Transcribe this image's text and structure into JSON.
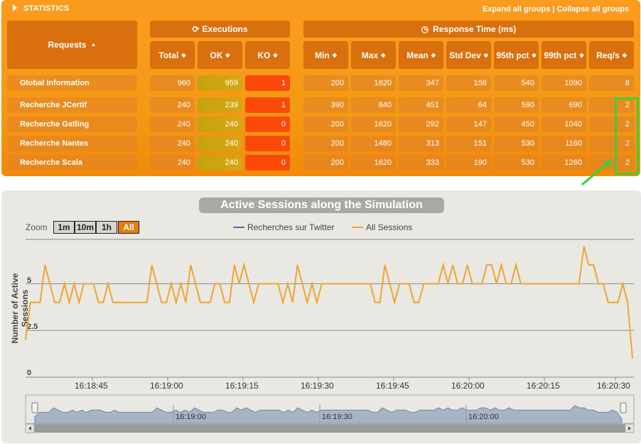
{
  "stats": {
    "title": "STATISTICS",
    "expand": "Expand all groups",
    "sep": " | ",
    "collapse": "Collapse all groups",
    "requests_header": "Requests",
    "executions_header": "Executions",
    "response_header": "Response Time (ms)",
    "columns": [
      "Total",
      "OK",
      "KO",
      "Min",
      "Max",
      "Mean",
      "Std Dev",
      "95th pct",
      "99th pct",
      "Req/s"
    ],
    "rows": [
      {
        "name": "Global Information",
        "total": "960",
        "ok": "959",
        "ko": "1",
        "min": "200",
        "max": "1620",
        "mean": "347",
        "std": "158",
        "p95": "540",
        "p99": "1090",
        "reqs": "8"
      },
      {
        "name": "Recherche JCertif",
        "total": "240",
        "ok": "239",
        "ko": "1",
        "min": "390",
        "max": "840",
        "mean": "451",
        "std": "64",
        "p95": "590",
        "p99": "690",
        "reqs": "2"
      },
      {
        "name": "Recherche Gatling",
        "total": "240",
        "ok": "240",
        "ko": "0",
        "min": "200",
        "max": "1620",
        "mean": "292",
        "std": "147",
        "p95": "450",
        "p99": "1040",
        "reqs": "2"
      },
      {
        "name": "Recherche Nantes",
        "total": "240",
        "ok": "240",
        "ko": "0",
        "min": "200",
        "max": "1480",
        "mean": "313",
        "std": "151",
        "p95": "530",
        "p99": "1160",
        "reqs": "2"
      },
      {
        "name": "Recherche Scala",
        "total": "240",
        "ok": "240",
        "ko": "0",
        "min": "200",
        "max": "1620",
        "mean": "333",
        "std": "190",
        "p95": "530",
        "p99": "1260",
        "reqs": "2"
      }
    ]
  },
  "chart": {
    "title": "Active Sessions along the Simulation",
    "zoom_label": "Zoom",
    "zoom_buttons": [
      "1m",
      "10m",
      "1h",
      "All"
    ],
    "ylabel": "Number of Active Sessions",
    "colors": {
      "twitter": "#4572a7",
      "all": "#f0a430"
    }
  },
  "chart_data": {
    "type": "line",
    "title": "Active Sessions along the Simulation",
    "ylabel": "Number of Active Sessions",
    "ylim": [
      0,
      7
    ],
    "yticks": [
      "0",
      "2.5",
      "5"
    ],
    "xticks": [
      "16:18:45",
      "16:19:00",
      "16:19:15",
      "16:19:30",
      "16:19:45",
      "16:20:00",
      "16:20:15",
      "16:20:30"
    ],
    "navigator_ticks": [
      "16:19:00",
      "16:19:30",
      "16:20:00"
    ],
    "series": [
      {
        "name": "Recherches sur Twitter",
        "values": []
      },
      {
        "name": "All Sessions",
        "values": [
          2,
          4,
          4,
          4,
          6,
          5,
          4,
          4,
          5,
          4,
          5,
          4,
          5,
          5,
          5,
          4,
          4,
          5,
          4,
          4,
          4,
          4,
          4,
          4,
          4,
          4,
          6,
          5,
          4,
          4,
          5,
          4,
          5,
          4,
          6,
          5,
          4,
          4,
          4,
          5,
          5,
          4,
          4,
          6,
          5,
          6,
          5,
          4,
          5,
          5,
          5,
          5,
          5,
          4,
          5,
          4,
          6,
          5,
          4,
          5,
          4,
          5,
          5,
          5,
          5,
          5,
          5,
          5,
          5,
          5,
          5,
          5,
          4,
          4,
          6,
          5,
          4,
          5,
          5,
          5,
          4,
          4,
          5,
          5,
          5,
          5,
          6,
          5,
          6,
          5,
          5,
          6,
          5,
          5,
          5,
          6,
          6,
          5,
          6,
          5,
          5,
          6,
          5,
          5,
          5,
          5,
          5,
          5,
          5,
          5,
          5,
          5,
          5,
          5,
          5,
          7,
          6,
          6,
          5,
          5,
          4,
          4,
          4,
          5,
          4,
          1
        ]
      }
    ]
  }
}
